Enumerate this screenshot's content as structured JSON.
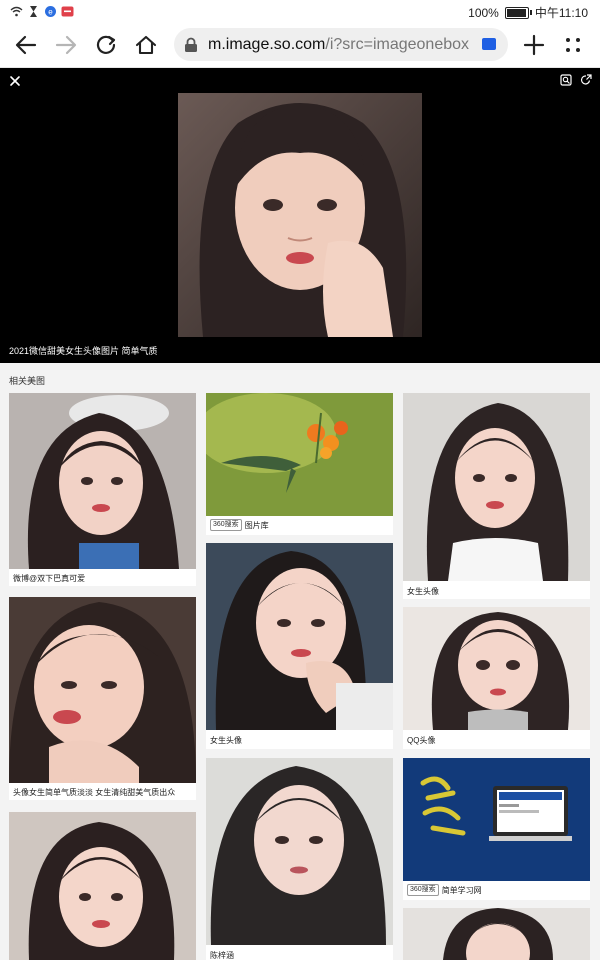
{
  "status_bar": {
    "battery": "100%",
    "time": "中午11:10"
  },
  "browser": {
    "url_host": "m.image.so.com",
    "url_path": "/i?src=imageonebox"
  },
  "viewer": {
    "caption": "2021微信甜美女生头像图片 简单气质"
  },
  "related": {
    "title": "相关美图",
    "cards": [
      {
        "caption": "微博@双下巴真可爱",
        "tag": ""
      },
      {
        "caption": "头像女生简单气质淡淡 女生清纯甜美气质出众",
        "tag": ""
      },
      {
        "caption": "",
        "tag": ""
      },
      {
        "caption": "图片库",
        "tag": "360搜索"
      },
      {
        "caption": "女生头像",
        "tag": ""
      },
      {
        "caption": "陈梓涵",
        "tag": ""
      },
      {
        "caption": "女生头像",
        "tag": ""
      },
      {
        "caption": "QQ头像",
        "tag": ""
      },
      {
        "caption": "简单学习网",
        "tag": "360搜索"
      },
      {
        "caption": "",
        "tag": ""
      }
    ]
  },
  "colors": {
    "viewer_bg": "#000000",
    "url_badge": "#1f5fe3",
    "page_bg": "#f3f3f3"
  }
}
